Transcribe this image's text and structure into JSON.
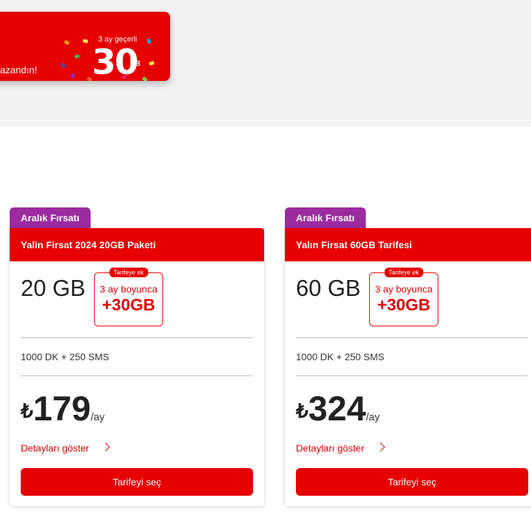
{
  "banner": {
    "text": "azandın!",
    "validity": "3 ay geçerli",
    "amount": "30",
    "unit": "GB"
  },
  "colors": {
    "brand": "#e60000",
    "badge": "#9c2aa0"
  },
  "plans": [
    {
      "badge": "Aralık Fırsatı",
      "title": "Yalin Firsat 2024 20GB Paketi",
      "data_amount": "20 GB",
      "bonus_tag": "Tarifeye ek",
      "bonus_duration": "3 ay boyunca",
      "bonus_amount": "+30GB",
      "minutes_sms": "1000 DK + 250 SMS",
      "currency": "₺",
      "price": "179",
      "period": "/ay",
      "details_label": "Detayları göster",
      "select_label": "Tarifeyi seç"
    },
    {
      "badge": "Aralık Fırsatı",
      "title": "Yalın Firsat 60GB Tarifesi",
      "data_amount": "60 GB",
      "bonus_tag": "Tarifeye ek",
      "bonus_duration": "3 ay boyunca",
      "bonus_amount": "+30GB",
      "minutes_sms": "1000 DK + 250 SMS",
      "currency": "₺",
      "price": "324",
      "period": "/ay",
      "details_label": "Detayları göster",
      "select_label": "Tarifeyi seç"
    }
  ]
}
